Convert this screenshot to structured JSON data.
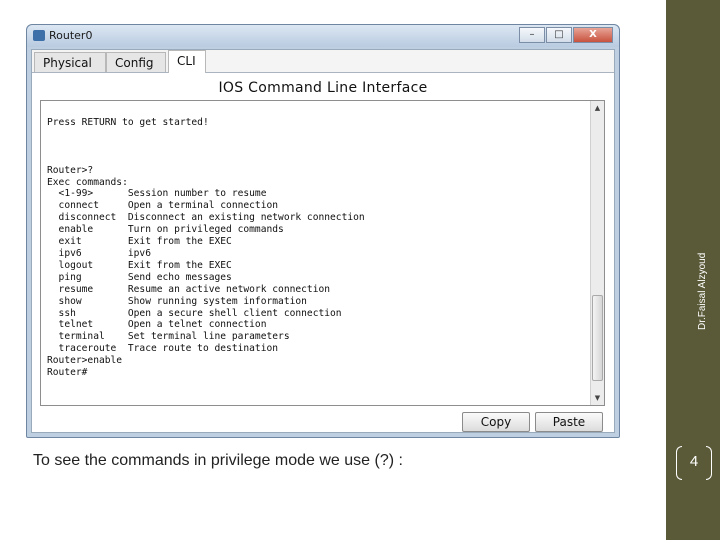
{
  "window": {
    "title": "Router0",
    "minimize_glyph": "–",
    "maximize_glyph": "□",
    "close_glyph": "X"
  },
  "tabs": [
    {
      "label": "Physical"
    },
    {
      "label": "Config"
    },
    {
      "label": "CLI",
      "active": true
    }
  ],
  "cli": {
    "heading": "IOS Command Line Interface",
    "terminal_text": "Press RETURN to get started!\n\n\n\nRouter>?\nExec commands:\n  <1-99>      Session number to resume\n  connect     Open a terminal connection\n  disconnect  Disconnect an existing network connection\n  enable      Turn on privileged commands\n  exit        Exit from the EXEC\n  ipv6        ipv6\n  logout      Exit from the EXEC\n  ping        Send echo messages\n  resume      Resume an active network connection\n  show        Show running system information\n  ssh         Open a secure shell client connection\n  telnet      Open a telnet connection\n  terminal    Set terminal line parameters\n  traceroute  Trace route to destination\nRouter>enable\nRouter#",
    "scroll_up_glyph": "▲",
    "scroll_down_glyph": "▼"
  },
  "buttons": {
    "copy": "Copy",
    "paste": "Paste"
  },
  "slide": {
    "caption": "To see the commands in privilege mode we use (?) :",
    "author": "Dr.Faisal Alzyoud",
    "page_number": "4",
    "sidebar_color": "#5a5a39"
  }
}
